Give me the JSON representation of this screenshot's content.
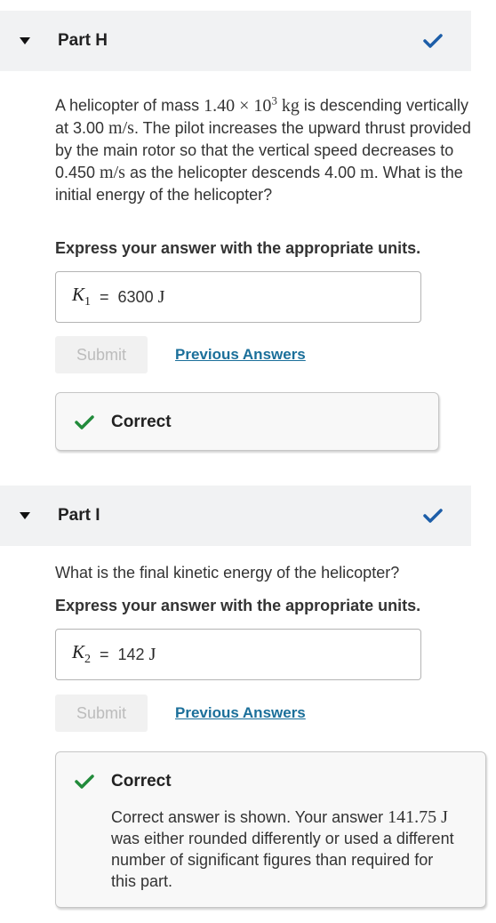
{
  "colors": {
    "check_blue": "#1d5ea8",
    "check_green": "#228b3b",
    "link": "#1b6f9a",
    "header_bg": "#f1f2f3"
  },
  "part_h": {
    "title": "Part H",
    "question": {
      "t1": "A helicopter of mass ",
      "mass": "1.40 × 10",
      "mass_exp": "3",
      "mass_unit": " kg",
      "t2": " is descending vertically at 3.00 ",
      "v1_unit": "m/s",
      "t3": ". The pilot increases the upward thrust provided by the main rotor so that the vertical speed decreases to 0.450 ",
      "v2_unit": "m/s",
      "t4": " as the helicopter descends 4.00 ",
      "d_unit": "m",
      "t5": ". What is the initial energy of the helicopter?"
    },
    "instruction": "Express your answer with the appropriate units.",
    "answer": {
      "var": "K",
      "sub": "1",
      "eq": "=",
      "value": "6300",
      "unit": "J"
    },
    "submit_label": "Submit",
    "previous_answers": "Previous Answers",
    "feedback": {
      "title": "Correct"
    }
  },
  "part_i": {
    "title": "Part I",
    "question": "What is the final kinetic energy of the helicopter?",
    "instruction": "Express your answer with the appropriate units.",
    "answer": {
      "var": "K",
      "sub": "2",
      "eq": "=",
      "value": "142",
      "unit": "J"
    },
    "submit_label": "Submit",
    "previous_answers": "Previous Answers",
    "feedback": {
      "title": "Correct",
      "m1": "Correct answer is shown. Your answer ",
      "value": "141.75 J",
      "m2": " was either rounded differently or used a different number of significant figures than required for this part."
    }
  }
}
